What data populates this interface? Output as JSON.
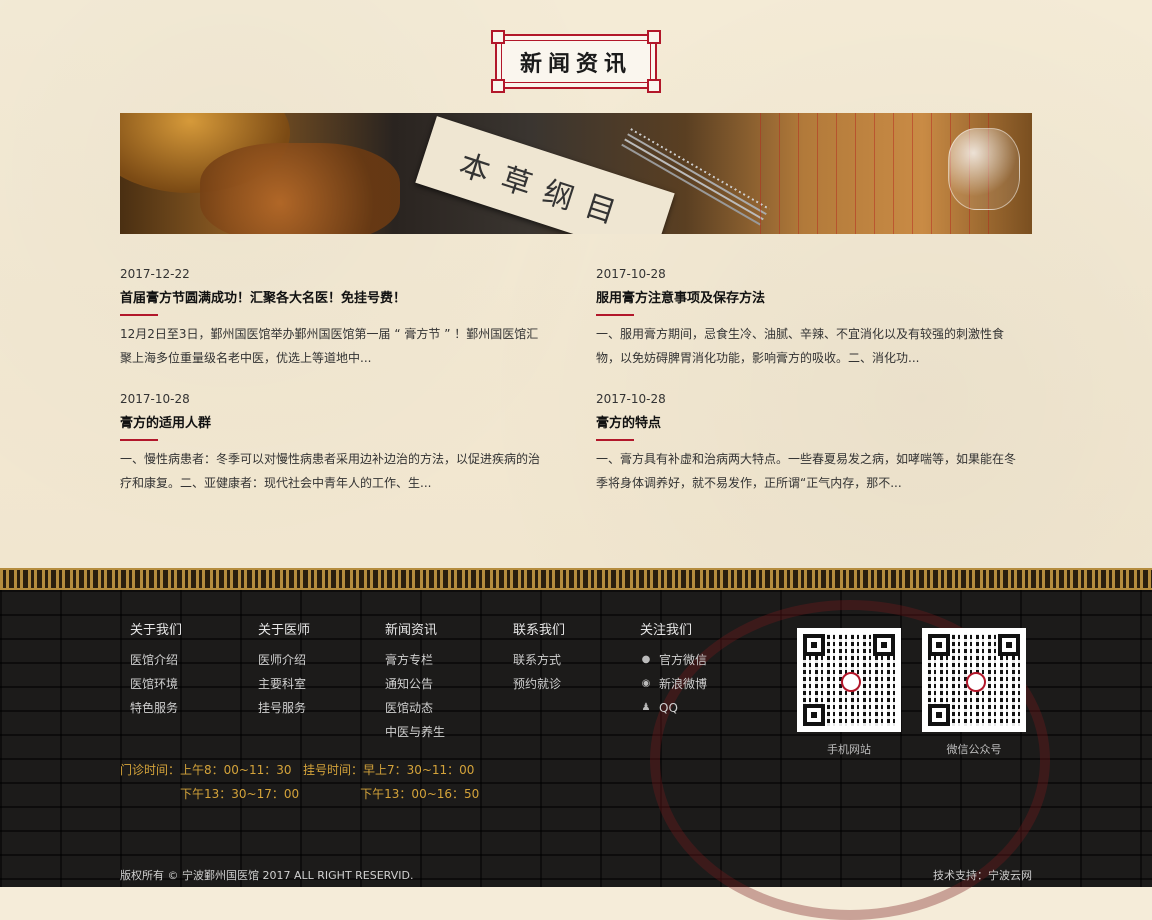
{
  "section": {
    "title": "新闻资讯"
  },
  "banner": {
    "book_text": "本草纲目"
  },
  "news": [
    {
      "date": "2017-12-22",
      "title": "首届膏方节圆满成功！汇聚各大名医！免挂号费！",
      "summary": "12月2日至3日，鄞州国医馆举办鄞州国医馆第一届 “ 膏方节 ” ！鄞州国医馆汇聚上海多位重量级名老中医，优选上等道地中..."
    },
    {
      "date": "2017-10-28",
      "title": "服用膏方注意事项及保存方法",
      "summary": "一、服用膏方期间，忌食生冷、油腻、辛辣、不宜消化以及有较强的刺激性食物，以免妨碍脾胃消化功能，影响膏方的吸收。二、消化功..."
    },
    {
      "date": "2017-10-28",
      "title": "膏方的适用人群",
      "summary": "一、慢性病患者：冬季可以对慢性病患者采用边补边治的方法，以促进疾病的治疗和康复。二、亚健康者：现代社会中青年人的工作、生..."
    },
    {
      "date": "2017-10-28",
      "title": "膏方的特点",
      "summary": "一、膏方具有补虚和治病两大特点。一些春夏易发之病，如哮喘等，如果能在冬季将身体调养好，就不易发作，正所谓“正气内存，那不..."
    }
  ],
  "footer": {
    "about": {
      "title": "关于我们",
      "links": [
        "医馆介绍",
        "医馆环境",
        "特色服务"
      ]
    },
    "doctors": {
      "title": "关于医师",
      "links": [
        "医师介绍",
        "主要科室",
        "挂号服务"
      ]
    },
    "news": {
      "title": "新闻资讯",
      "links": [
        "膏方专栏",
        "通知公告",
        "医馆动态",
        "中医与养生"
      ]
    },
    "contact": {
      "title": "联系我们",
      "links": [
        "联系方式",
        "预约就诊"
      ]
    },
    "follow": {
      "title": "关注我们",
      "links": [
        {
          "icon": "wechat-icon",
          "label": "官方微信"
        },
        {
          "icon": "weibo-icon",
          "label": "新浪微博"
        },
        {
          "icon": "qq-icon",
          "label": "QQ"
        }
      ]
    },
    "qr": [
      {
        "caption": "手机网站"
      },
      {
        "caption": "微信公众号"
      }
    ],
    "hours_line1": "门诊时间：上午8：00~11：30   挂号时间：早上7：30~11：00",
    "hours_line2": "下午13：30~17：00                下午13：00~16：50",
    "copyright": "版权所有 © 宁波鄞州国医馆 2017 ALL RIGHT RESERVID.",
    "tech_support": "技术支持：宁波云网"
  },
  "colors": {
    "accent": "#b2172a",
    "gold": "#d4a33a"
  }
}
